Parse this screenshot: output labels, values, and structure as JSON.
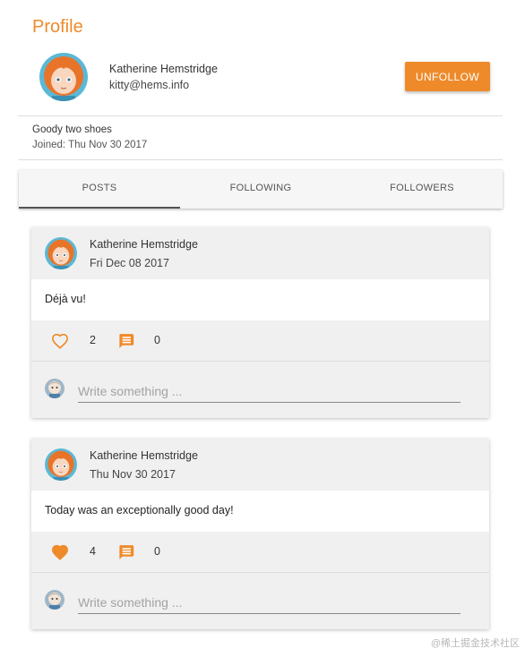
{
  "page": {
    "title": "Profile"
  },
  "profile": {
    "name": "Katherine Hemstridge",
    "email": "kitty@hems.info",
    "bio": "Goody two shoes",
    "joined": "Joined: Thu Nov 30 2017",
    "unfollow_label": "UNFOLLOW",
    "avatar_icon": "avatar-orange-hair-icon"
  },
  "tabs": [
    {
      "label": "POSTS",
      "active": true
    },
    {
      "label": "FOLLOWING",
      "active": false
    },
    {
      "label": "FOLLOWERS",
      "active": false
    }
  ],
  "posts": [
    {
      "author": "Katherine Hemstridge",
      "date": "Fri Dec 08 2017",
      "text": "Déjà vu!",
      "likes": "2",
      "liked": false,
      "comments": "0",
      "comment_placeholder": "Write something ..."
    },
    {
      "author": "Katherine Hemstridge",
      "date": "Thu Nov 30 2017",
      "text": "Today was an exceptionally good day!",
      "likes": "4",
      "liked": true,
      "comments": "0",
      "comment_placeholder": "Write something ..."
    }
  ],
  "watermark": "@稀土掘金技术社区",
  "colors": {
    "accent": "#ee8a2a",
    "card_bg": "#f0f0f0",
    "divider": "#dedede"
  }
}
